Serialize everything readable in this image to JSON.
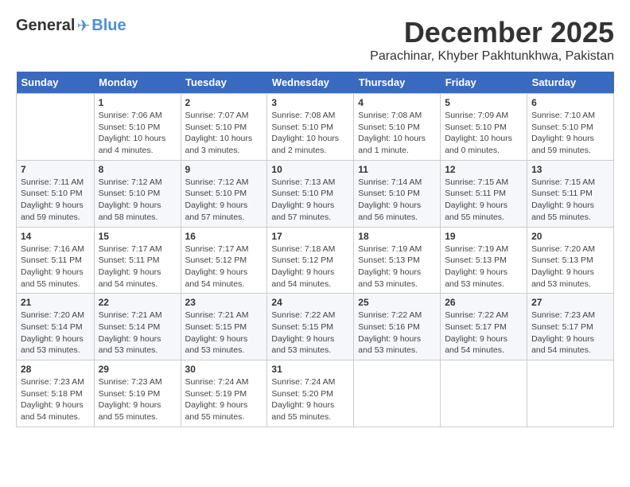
{
  "header": {
    "logo_general": "General",
    "logo_blue": "Blue",
    "title": "December 2025",
    "location": "Parachinar, Khyber Pakhtunkhwa, Pakistan"
  },
  "days_of_week": [
    "Sunday",
    "Monday",
    "Tuesday",
    "Wednesday",
    "Thursday",
    "Friday",
    "Saturday"
  ],
  "weeks": [
    [
      {
        "day": "",
        "sunrise": "",
        "sunset": "",
        "daylight": ""
      },
      {
        "day": "1",
        "sunrise": "Sunrise: 7:06 AM",
        "sunset": "Sunset: 5:10 PM",
        "daylight": "Daylight: 10 hours and 4 minutes."
      },
      {
        "day": "2",
        "sunrise": "Sunrise: 7:07 AM",
        "sunset": "Sunset: 5:10 PM",
        "daylight": "Daylight: 10 hours and 3 minutes."
      },
      {
        "day": "3",
        "sunrise": "Sunrise: 7:08 AM",
        "sunset": "Sunset: 5:10 PM",
        "daylight": "Daylight: 10 hours and 2 minutes."
      },
      {
        "day": "4",
        "sunrise": "Sunrise: 7:08 AM",
        "sunset": "Sunset: 5:10 PM",
        "daylight": "Daylight: 10 hours and 1 minute."
      },
      {
        "day": "5",
        "sunrise": "Sunrise: 7:09 AM",
        "sunset": "Sunset: 5:10 PM",
        "daylight": "Daylight: 10 hours and 0 minutes."
      },
      {
        "day": "6",
        "sunrise": "Sunrise: 7:10 AM",
        "sunset": "Sunset: 5:10 PM",
        "daylight": "Daylight: 9 hours and 59 minutes."
      }
    ],
    [
      {
        "day": "7",
        "sunrise": "Sunrise: 7:11 AM",
        "sunset": "Sunset: 5:10 PM",
        "daylight": "Daylight: 9 hours and 59 minutes."
      },
      {
        "day": "8",
        "sunrise": "Sunrise: 7:12 AM",
        "sunset": "Sunset: 5:10 PM",
        "daylight": "Daylight: 9 hours and 58 minutes."
      },
      {
        "day": "9",
        "sunrise": "Sunrise: 7:12 AM",
        "sunset": "Sunset: 5:10 PM",
        "daylight": "Daylight: 9 hours and 57 minutes."
      },
      {
        "day": "10",
        "sunrise": "Sunrise: 7:13 AM",
        "sunset": "Sunset: 5:10 PM",
        "daylight": "Daylight: 9 hours and 57 minutes."
      },
      {
        "day": "11",
        "sunrise": "Sunrise: 7:14 AM",
        "sunset": "Sunset: 5:10 PM",
        "daylight": "Daylight: 9 hours and 56 minutes."
      },
      {
        "day": "12",
        "sunrise": "Sunrise: 7:15 AM",
        "sunset": "Sunset: 5:11 PM",
        "daylight": "Daylight: 9 hours and 55 minutes."
      },
      {
        "day": "13",
        "sunrise": "Sunrise: 7:15 AM",
        "sunset": "Sunset: 5:11 PM",
        "daylight": "Daylight: 9 hours and 55 minutes."
      }
    ],
    [
      {
        "day": "14",
        "sunrise": "Sunrise: 7:16 AM",
        "sunset": "Sunset: 5:11 PM",
        "daylight": "Daylight: 9 hours and 55 minutes."
      },
      {
        "day": "15",
        "sunrise": "Sunrise: 7:17 AM",
        "sunset": "Sunset: 5:11 PM",
        "daylight": "Daylight: 9 hours and 54 minutes."
      },
      {
        "day": "16",
        "sunrise": "Sunrise: 7:17 AM",
        "sunset": "Sunset: 5:12 PM",
        "daylight": "Daylight: 9 hours and 54 minutes."
      },
      {
        "day": "17",
        "sunrise": "Sunrise: 7:18 AM",
        "sunset": "Sunset: 5:12 PM",
        "daylight": "Daylight: 9 hours and 54 minutes."
      },
      {
        "day": "18",
        "sunrise": "Sunrise: 7:19 AM",
        "sunset": "Sunset: 5:13 PM",
        "daylight": "Daylight: 9 hours and 53 minutes."
      },
      {
        "day": "19",
        "sunrise": "Sunrise: 7:19 AM",
        "sunset": "Sunset: 5:13 PM",
        "daylight": "Daylight: 9 hours and 53 minutes."
      },
      {
        "day": "20",
        "sunrise": "Sunrise: 7:20 AM",
        "sunset": "Sunset: 5:13 PM",
        "daylight": "Daylight: 9 hours and 53 minutes."
      }
    ],
    [
      {
        "day": "21",
        "sunrise": "Sunrise: 7:20 AM",
        "sunset": "Sunset: 5:14 PM",
        "daylight": "Daylight: 9 hours and 53 minutes."
      },
      {
        "day": "22",
        "sunrise": "Sunrise: 7:21 AM",
        "sunset": "Sunset: 5:14 PM",
        "daylight": "Daylight: 9 hours and 53 minutes."
      },
      {
        "day": "23",
        "sunrise": "Sunrise: 7:21 AM",
        "sunset": "Sunset: 5:15 PM",
        "daylight": "Daylight: 9 hours and 53 minutes."
      },
      {
        "day": "24",
        "sunrise": "Sunrise: 7:22 AM",
        "sunset": "Sunset: 5:15 PM",
        "daylight": "Daylight: 9 hours and 53 minutes."
      },
      {
        "day": "25",
        "sunrise": "Sunrise: 7:22 AM",
        "sunset": "Sunset: 5:16 PM",
        "daylight": "Daylight: 9 hours and 53 minutes."
      },
      {
        "day": "26",
        "sunrise": "Sunrise: 7:22 AM",
        "sunset": "Sunset: 5:17 PM",
        "daylight": "Daylight: 9 hours and 54 minutes."
      },
      {
        "day": "27",
        "sunrise": "Sunrise: 7:23 AM",
        "sunset": "Sunset: 5:17 PM",
        "daylight": "Daylight: 9 hours and 54 minutes."
      }
    ],
    [
      {
        "day": "28",
        "sunrise": "Sunrise: 7:23 AM",
        "sunset": "Sunset: 5:18 PM",
        "daylight": "Daylight: 9 hours and 54 minutes."
      },
      {
        "day": "29",
        "sunrise": "Sunrise: 7:23 AM",
        "sunset": "Sunset: 5:19 PM",
        "daylight": "Daylight: 9 hours and 55 minutes."
      },
      {
        "day": "30",
        "sunrise": "Sunrise: 7:24 AM",
        "sunset": "Sunset: 5:19 PM",
        "daylight": "Daylight: 9 hours and 55 minutes."
      },
      {
        "day": "31",
        "sunrise": "Sunrise: 7:24 AM",
        "sunset": "Sunset: 5:20 PM",
        "daylight": "Daylight: 9 hours and 55 minutes."
      },
      {
        "day": "",
        "sunrise": "",
        "sunset": "",
        "daylight": ""
      },
      {
        "day": "",
        "sunrise": "",
        "sunset": "",
        "daylight": ""
      },
      {
        "day": "",
        "sunrise": "",
        "sunset": "",
        "daylight": ""
      }
    ]
  ]
}
